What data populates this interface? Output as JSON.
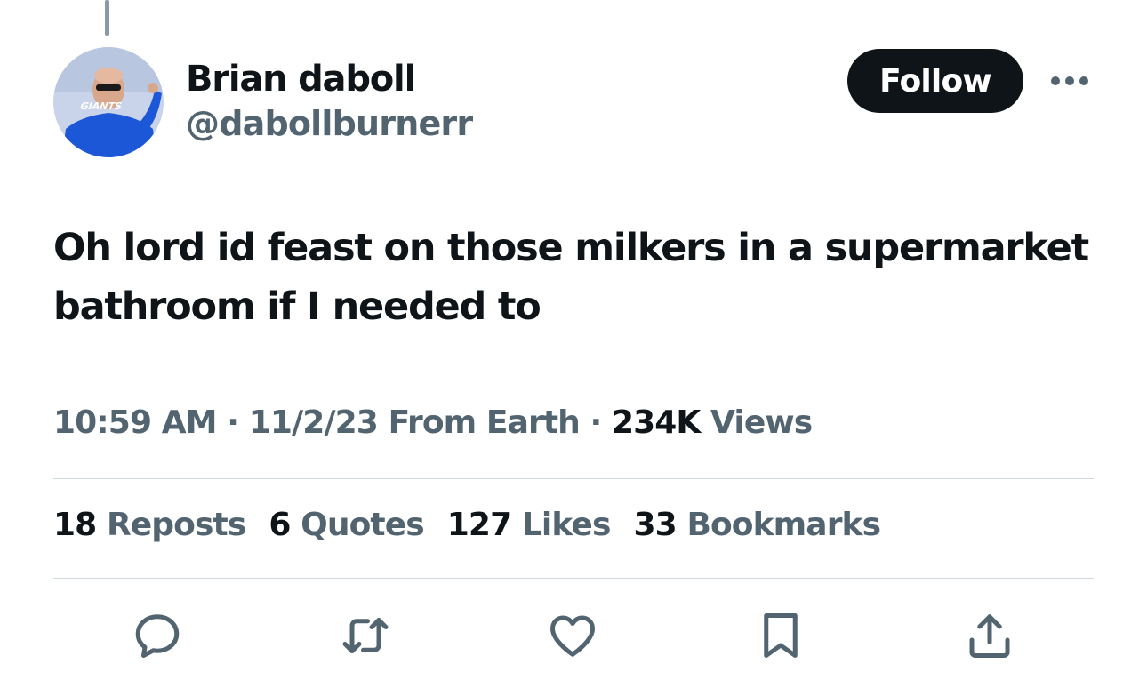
{
  "author": {
    "name": "Brian daboll",
    "handle": "@dabollburnerr",
    "avatar_jersey_text": "GIANTS"
  },
  "follow_button": {
    "label": "Follow"
  },
  "more_button": {
    "icon": "more-horizontal-icon"
  },
  "tweet": {
    "text": "Oh lord id feast on those milkers in a supermarket bathroom if I needed to"
  },
  "meta": {
    "time": "10:59 AM",
    "separator": "·",
    "date": "11/2/23",
    "source": "From Earth",
    "views_count": "234K",
    "views_label": "Views"
  },
  "stats": [
    {
      "count": "18",
      "label": "Reposts"
    },
    {
      "count": "6",
      "label": "Quotes"
    },
    {
      "count": "127",
      "label": "Likes"
    },
    {
      "count": "33",
      "label": "Bookmarks"
    }
  ],
  "actions": [
    {
      "icon": "reply-icon"
    },
    {
      "icon": "repost-icon"
    },
    {
      "icon": "like-icon"
    },
    {
      "icon": "bookmark-icon"
    },
    {
      "icon": "share-icon"
    }
  ],
  "colors": {
    "primary_text": "#0f1419",
    "secondary_text": "#536471",
    "divider": "#cfd9de",
    "button_bg": "#0f1419"
  }
}
